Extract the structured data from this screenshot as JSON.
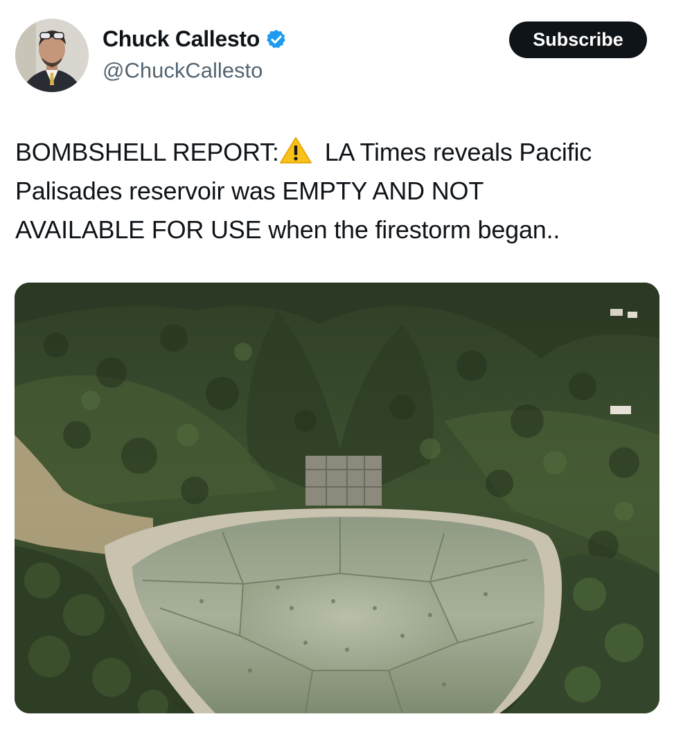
{
  "author": {
    "display_name": "Chuck Callesto",
    "handle": "@ChuckCallesto",
    "verified_icon": "verified-badge-icon",
    "avatar_icon": "profile-photo"
  },
  "subscribe_label": "Subscribe",
  "tweet": {
    "line1_start": "BOMBSHELL REPORT:",
    "warning_icon": "warning-sign-icon",
    "line1_end": "LA Times reveals Pacific",
    "line2": "Palisades reservoir was EMPTY AND NOT",
    "line3": "AVAILABLE FOR USE when the firestorm began.."
  },
  "media": {
    "type": "photo",
    "icon": "aerial-reservoir-photo"
  },
  "colors": {
    "text": "#0f1419",
    "secondary_text": "#536471",
    "verified": "#1d9bf0",
    "button_bg": "#0f1419",
    "button_text": "#ffffff",
    "warning": "#f7c21a"
  }
}
